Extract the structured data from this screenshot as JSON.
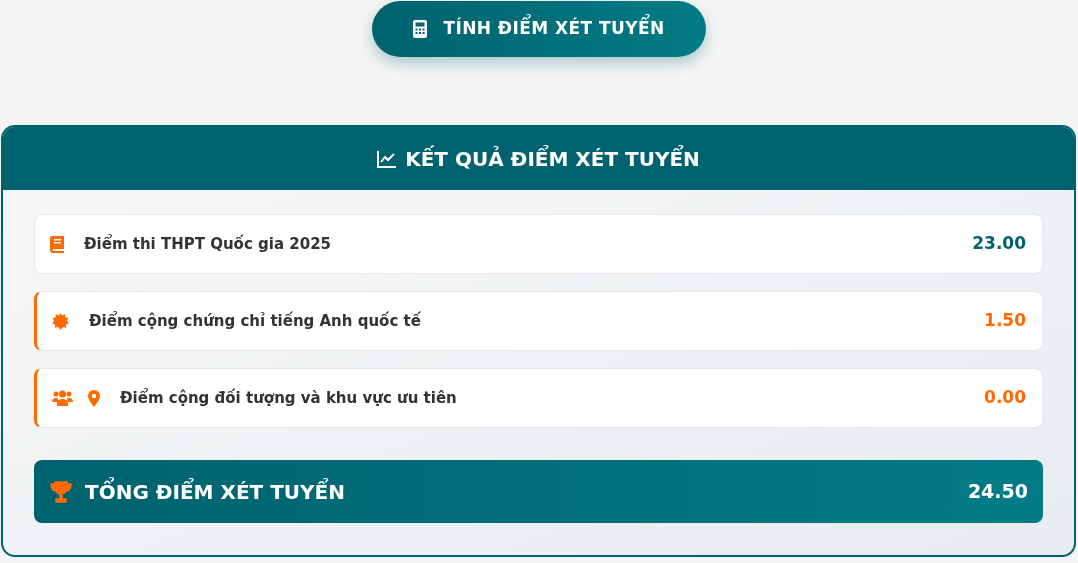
{
  "calculate_button": {
    "label": "TÍNH ĐIỂM XÉT TUYỂN"
  },
  "result_card": {
    "title": "KẾT QUẢ ĐIỂM XÉT TUYỂN",
    "rows": [
      {
        "kind": "base",
        "label": "Điểm thi THPT Quốc gia 2025",
        "value": "23.00"
      },
      {
        "kind": "bonus",
        "label": "Điểm cộng chứng chỉ tiếng Anh quốc tế",
        "value": "1.50"
      },
      {
        "kind": "bonus",
        "label": "Điểm cộng đối tượng và khu vực ưu tiên",
        "value": "0.00"
      }
    ],
    "total": {
      "label": "TỔNG ĐIỂM XÉT TUYỂN",
      "value": "24.50"
    }
  }
}
